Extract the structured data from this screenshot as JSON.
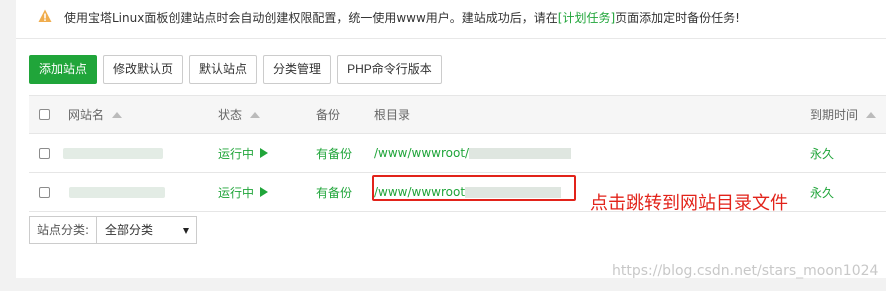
{
  "notice": {
    "text_before": "使用宝塔Linux面板创建站点时会自动创建权限配置，统一使用www用户。建站成功后，请在",
    "link": "[计划任务]",
    "text_after": "页面添加定时备份任务!",
    "icon": "warning-icon",
    "icon_color": "#f0ad4e"
  },
  "toolbar": {
    "add_site": "添加站点",
    "edit_default_page": "修改默认页",
    "default_site": "默认站点",
    "category_manage": "分类管理",
    "php_cli_version": "PHP命令行版本"
  },
  "table": {
    "headers": {
      "name": "网站名",
      "status": "状态",
      "backup": "备份",
      "root": "根目录",
      "expire": "到期时间"
    },
    "rows": [
      {
        "status": "运行中",
        "backup": "有备份",
        "root": "/www/wwwroot/",
        "expire": "永久"
      },
      {
        "status": "运行中",
        "backup": "有备份",
        "root": "/www/wwwroot",
        "expire": "永久"
      }
    ]
  },
  "annotation": "点击跳转到网站目录文件",
  "filter": {
    "label": "站点分类:",
    "selected": "全部分类"
  },
  "watermark": "https://blog.csdn.net/stars_moon1024",
  "colors": {
    "accent": "#20a53a",
    "annotation": "#e2231a"
  }
}
